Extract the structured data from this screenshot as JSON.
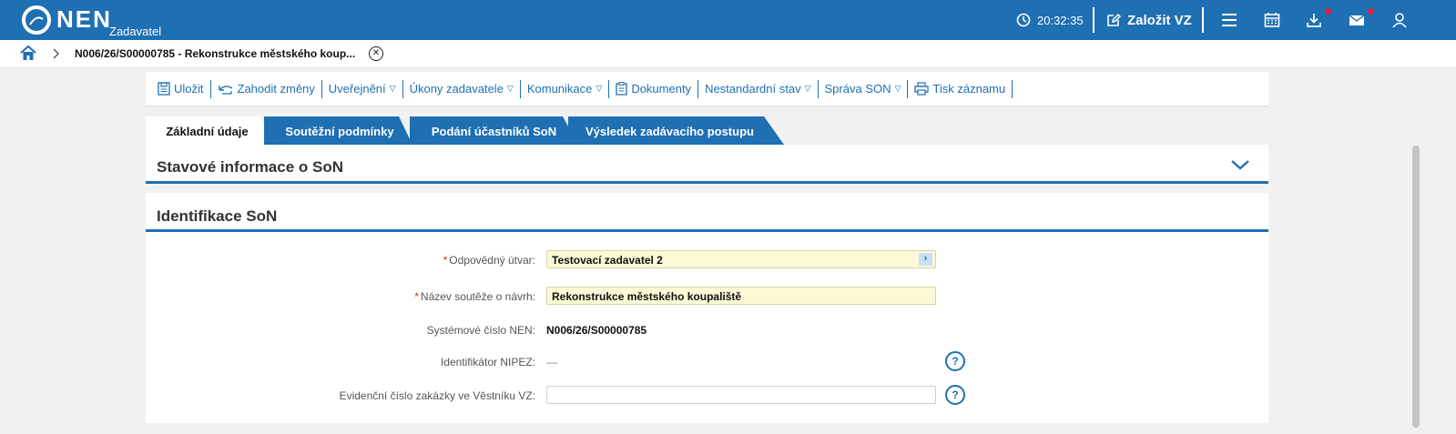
{
  "topbar": {
    "brand": "NEN",
    "brand_sub": "Zadavatel",
    "clock": "20:32:35",
    "create_label": "Založit VZ",
    "icons": [
      "clock-icon",
      "edit-icon",
      "menu-icon",
      "calendar-icon",
      "download-icon",
      "mail-icon",
      "user-icon"
    ],
    "colors": {
      "bar": "#1f6fb3",
      "badge": "#e0203a"
    }
  },
  "breadcrumb": {
    "text": "N006/26/S00000785 - Rekonstrukce městského koup..."
  },
  "toolbar": {
    "items": [
      {
        "label": "Uložit",
        "icon": "save-icon"
      },
      {
        "label": "Zahodit změny",
        "icon": "undo-icon"
      },
      {
        "label": "Uveřejnění",
        "dropdown": true
      },
      {
        "label": "Úkony zadavatele",
        "dropdown": true
      },
      {
        "label": "Komunikace",
        "dropdown": true
      },
      {
        "label": "Dokumenty",
        "icon": "clipboard-icon"
      },
      {
        "label": "Nestandardní stav",
        "dropdown": true
      },
      {
        "label": "Správa SON",
        "dropdown": true
      },
      {
        "label": "Tisk záznamu",
        "icon": "print-icon"
      }
    ]
  },
  "tabs": [
    {
      "label": "Základní údaje",
      "active": true
    },
    {
      "label": "Soutěžní podmínky",
      "active": false
    },
    {
      "label": "Podání účastníků SoN",
      "active": false
    },
    {
      "label": "Výsledek zadávacího postupu",
      "active": false
    }
  ],
  "sections": {
    "status_title": "Stavové informace o SoN",
    "ident_title": "Identifikace SoN"
  },
  "form": {
    "unit_label": "Odpovědný útvar:",
    "unit_value": "Testovací zadavatel 2",
    "name_label": "Název soutěže o návrh:",
    "name_value": "Rekonstrukce městského koupaliště",
    "sysnum_label": "Systémové číslo NEN:",
    "sysnum_value": "N006/26/S00000785",
    "nipez_label": "Identifikátor NIPEZ:",
    "nipez_value": "—",
    "evid_label": "Evidenční číslo zakázky ve Věstníku VZ:",
    "evid_value": ""
  }
}
